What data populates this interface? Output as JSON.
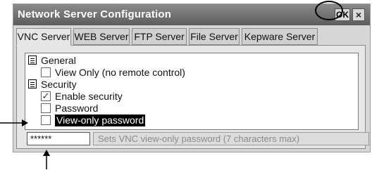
{
  "window": {
    "title": "Network Server Configuration",
    "ok_label": "OK",
    "close_glyph": "×"
  },
  "tabs": [
    {
      "label": "VNC Server",
      "active": true
    },
    {
      "label": "WEB Server",
      "active": false
    },
    {
      "label": "FTP Server",
      "active": false
    },
    {
      "label": "File Server",
      "active": false
    },
    {
      "label": "Kepware Server",
      "active": false
    }
  ],
  "tree": {
    "groups": [
      {
        "label": "General",
        "icon": "list-icon",
        "items": [
          {
            "label": "View Only (no remote control)",
            "checked": false
          }
        ]
      },
      {
        "label": "Security",
        "icon": "list-icon",
        "items": [
          {
            "label": "Enable security",
            "checked": true
          },
          {
            "label": "Password",
            "checked": false
          },
          {
            "label": "View-only password",
            "checked": false,
            "selected": true
          }
        ]
      }
    ]
  },
  "password_field": {
    "value": "******"
  },
  "help_text": "Sets VNC view-only password (7 characters max)",
  "glyphs": {
    "checkmark": "✓"
  },
  "colors": {
    "titlebar": "#6e6e6e",
    "selection": "#000000",
    "panel": "#e6e6e6"
  }
}
